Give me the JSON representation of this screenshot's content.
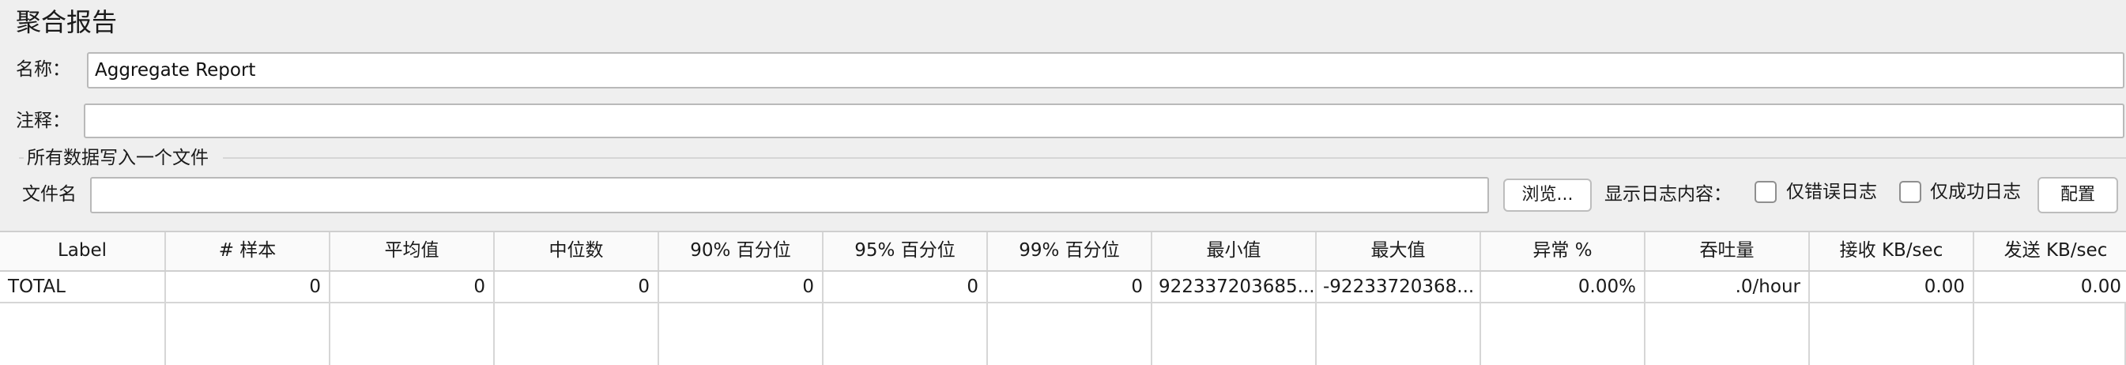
{
  "panel": {
    "title": "聚合报告"
  },
  "name": {
    "label": "名称：",
    "value": "Aggregate Report"
  },
  "comments": {
    "label": "注释：",
    "value": ""
  },
  "file_group": {
    "title": "所有数据写入一个文件",
    "filename_label": "文件名",
    "filename_value": "",
    "browse_label": "浏览...",
    "log_content_label": "显示日志内容：",
    "errors_only_label": "仅错误日志",
    "errors_only_checked": false,
    "success_only_label": "仅成功日志",
    "success_only_checked": false,
    "configure_label": "配置"
  },
  "table": {
    "columns": [
      "Label",
      "# 样本",
      "平均值",
      "中位数",
      "90% 百分位",
      "95% 百分位",
      "99% 百分位",
      "最小值",
      "最大值",
      "异常 %",
      "吞吐量",
      "接收 KB/sec",
      "发送 KB/sec"
    ],
    "rows": [
      [
        "TOTAL",
        "0",
        "0",
        "0",
        "0",
        "0",
        "0",
        "922337203685...",
        "-92233720368...",
        "0.00%",
        ".0/hour",
        "0.00",
        "0.00"
      ]
    ]
  }
}
